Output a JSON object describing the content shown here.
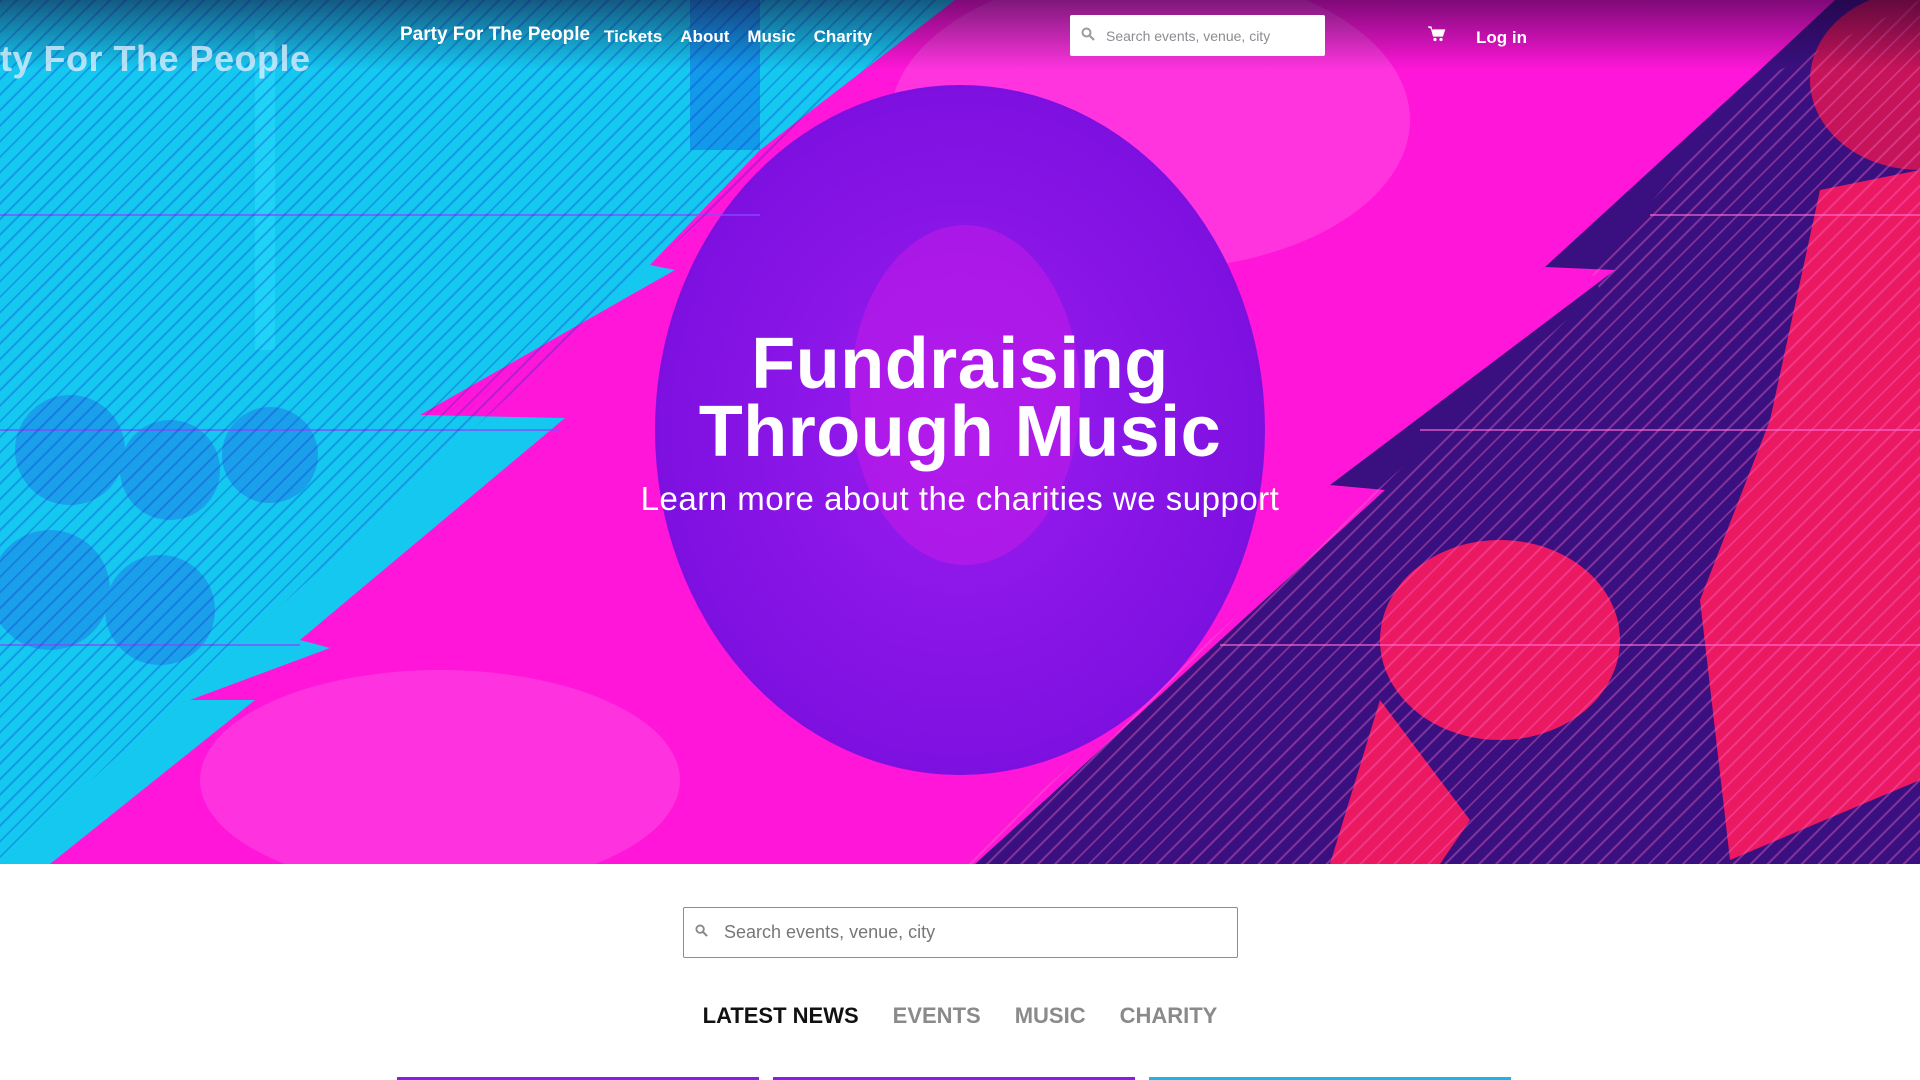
{
  "brand_ghost": "ty For The People",
  "nav": {
    "brand": "Party For The People",
    "links": [
      {
        "label": "Tickets"
      },
      {
        "label": "About"
      },
      {
        "label": "Music"
      },
      {
        "label": "Charity"
      }
    ],
    "search_placeholder": "Search events, venue, city",
    "login_label": "Log in"
  },
  "hero": {
    "title_line1": "Fundraising",
    "title_line2": "Through Music",
    "subtitle": "Learn more about the charities we support"
  },
  "main_search": {
    "placeholder": "Search events, venue, city"
  },
  "tabs": [
    {
      "label": "LATEST NEWS",
      "active": true
    },
    {
      "label": "EVENTS",
      "active": false
    },
    {
      "label": "MUSIC",
      "active": false
    },
    {
      "label": "CHARITY",
      "active": false
    }
  ],
  "icons": {
    "search": "search-icon",
    "cart": "shopping-cart-icon"
  },
  "colors": {
    "cyan": "#15d4f2",
    "magenta": "#ff16d8",
    "violet": "#8a14e8",
    "crimson": "#e8154f",
    "accent_border": "#1bb6e6",
    "card_line_1": "#8b1de8",
    "card_line_2": "#8b1de8",
    "card_line_3": "#1bb6e6"
  }
}
